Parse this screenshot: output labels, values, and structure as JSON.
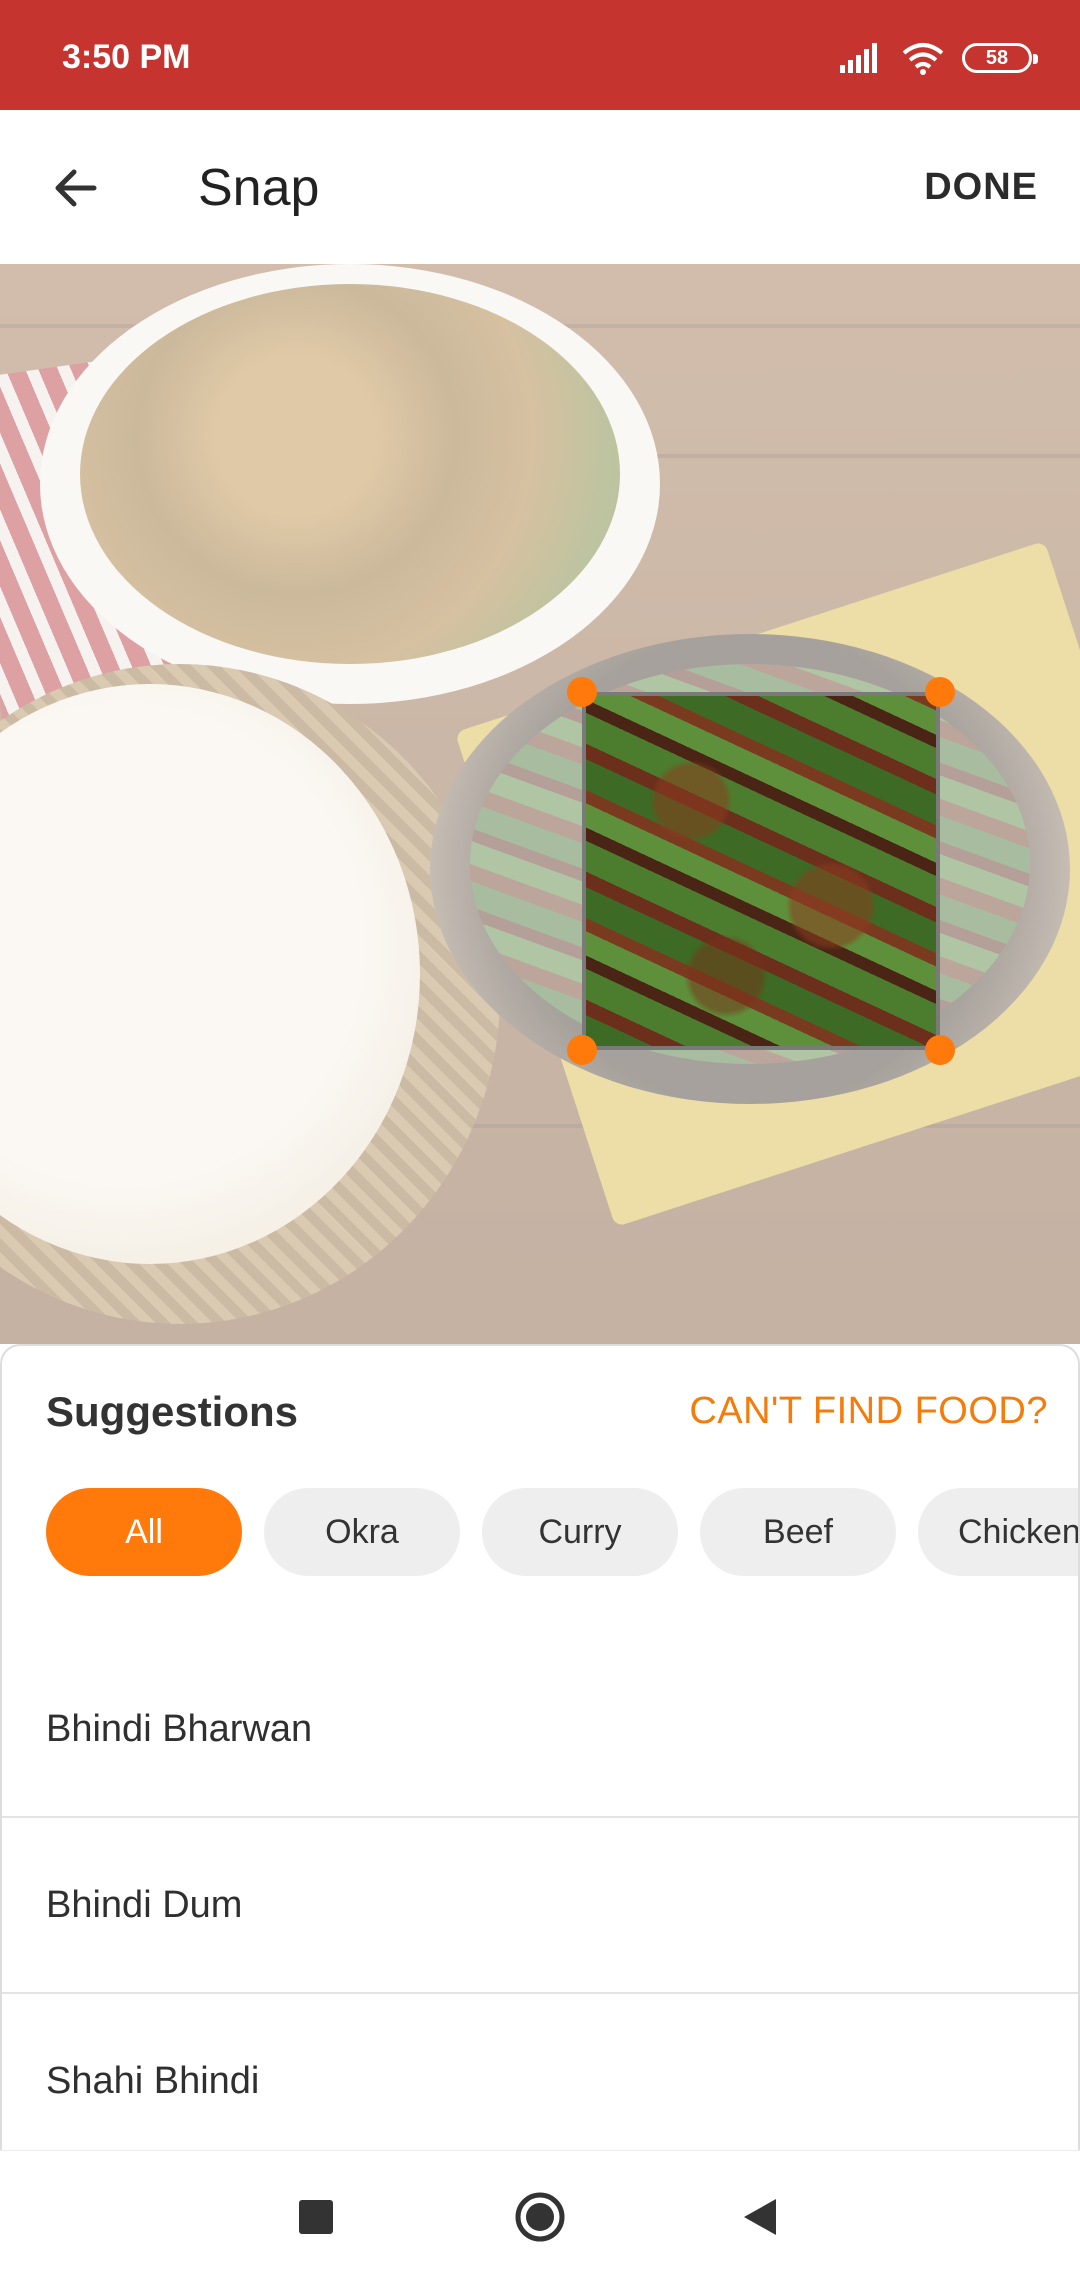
{
  "status_bar": {
    "time": "3:50 PM",
    "battery": "58",
    "icons": [
      "signal-icon",
      "wifi-icon",
      "battery-icon"
    ]
  },
  "app_bar": {
    "title": "Snap",
    "back_icon": "arrow-left-icon",
    "done_label": "DONE"
  },
  "photo": {
    "description_icon": "food-photo",
    "crop_handles": 4
  },
  "suggestions": {
    "title": "Suggestions",
    "cant_find_label": "CAN'T FIND FOOD?",
    "chips": [
      {
        "label": "All",
        "active": true
      },
      {
        "label": "Okra",
        "active": false
      },
      {
        "label": "Curry",
        "active": false
      },
      {
        "label": "Beef",
        "active": false
      },
      {
        "label": "Chicken",
        "active": false
      }
    ],
    "items": [
      "Bhindi Bharwan",
      "Bhindi Dum",
      "Shahi Bhindi"
    ]
  },
  "nav_bar": {
    "icons": [
      "recent-apps-icon",
      "home-icon",
      "back-icon"
    ]
  },
  "colors": {
    "status_bar": "#c5342e",
    "accent": "#ff7a0a",
    "chip_bg": "#eeeeee"
  }
}
